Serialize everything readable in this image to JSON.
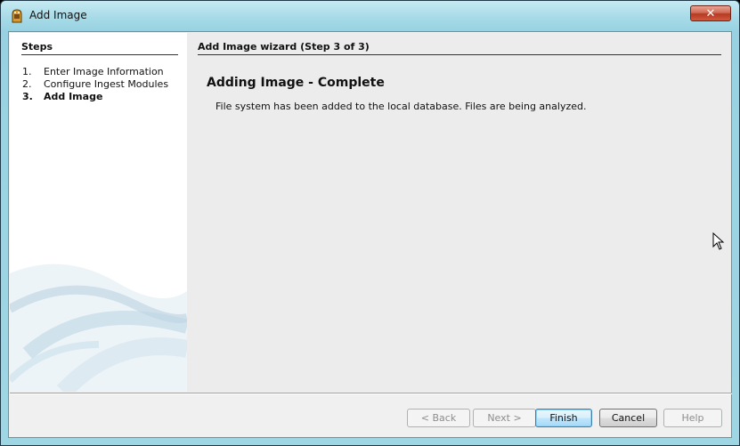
{
  "window": {
    "title": "Add Image",
    "close_symbol": "✕",
    "icon": "app-badge-icon"
  },
  "steps": {
    "heading": "Steps",
    "items": [
      {
        "number": "1.",
        "label": "Enter Image Information",
        "current": false
      },
      {
        "number": "2.",
        "label": "Configure Ingest Modules",
        "current": false
      },
      {
        "number": "3.",
        "label": "Add Image",
        "current": true
      }
    ]
  },
  "main": {
    "heading": "Add Image wizard (Step 3 of 3)",
    "title": "Adding Image - Complete",
    "message": "File system has been added to the local database. Files are being analyzed."
  },
  "buttons": {
    "back": "< Back",
    "next": "Next >",
    "finish": "Finish",
    "cancel": "Cancel",
    "help": "Help"
  },
  "colors": {
    "frame": "#9fd6e4",
    "close": "#c5462c",
    "default_button": "#3c7fb1"
  }
}
